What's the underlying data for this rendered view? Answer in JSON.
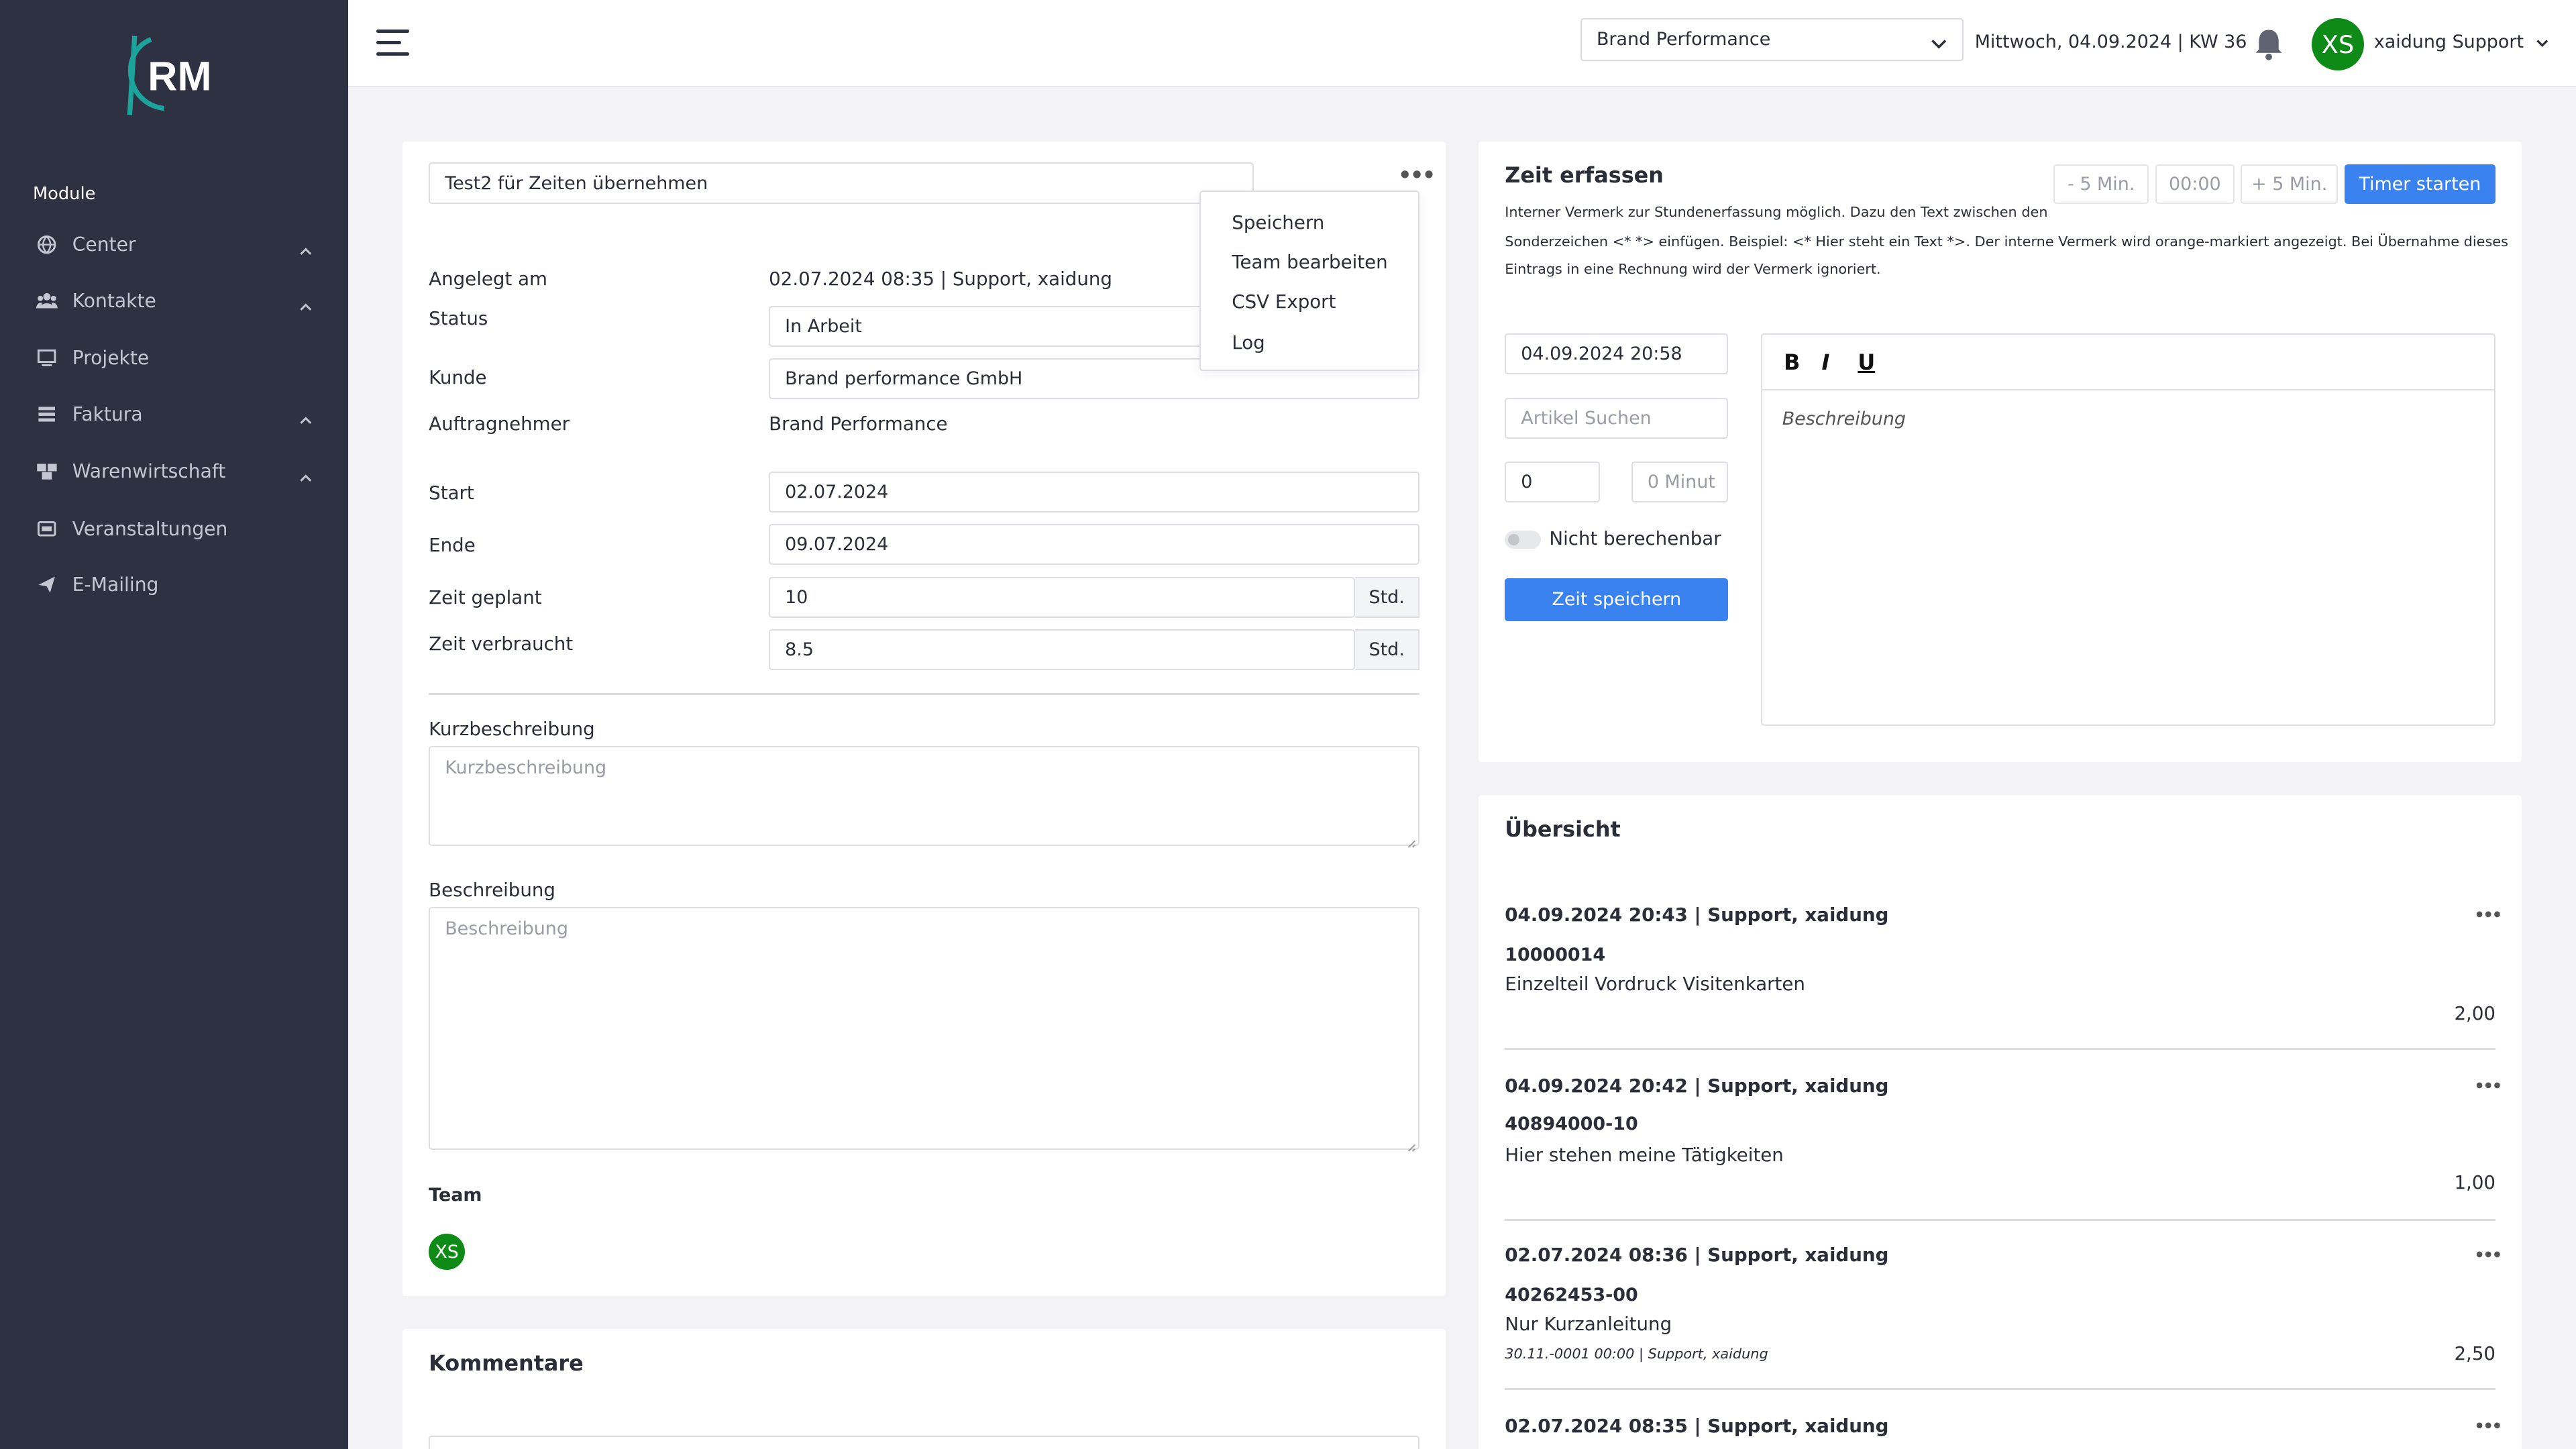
{
  "sidebar": {
    "logo_text": "RM",
    "section_label": "Module",
    "items": [
      {
        "label": "Center",
        "icon": "globe-icon",
        "expandable": true
      },
      {
        "label": "Kontakte",
        "icon": "users-icon",
        "expandable": true
      },
      {
        "label": "Projekte",
        "icon": "monitor-icon",
        "expandable": false
      },
      {
        "label": "Faktura",
        "icon": "stack-icon",
        "expandable": true
      },
      {
        "label": "Warenwirtschaft",
        "icon": "boxes-icon",
        "expandable": true
      },
      {
        "label": "Veranstaltungen",
        "icon": "ticket-icon",
        "expandable": false
      },
      {
        "label": "E-Mailing",
        "icon": "paper-plane-icon",
        "expandable": false
      }
    ]
  },
  "topbar": {
    "brand_select": "Brand Performance",
    "date_text": "Mittwoch, 04.09.2024 | KW 36",
    "user_initials": "XS",
    "user_name": "xaidung Support"
  },
  "project": {
    "title": "Test2 für Zeiten übernehmen",
    "menu": [
      "Speichern",
      "Team bearbeiten",
      "CSV Export",
      "Log"
    ],
    "created_label": "Angelegt am",
    "created_value": "02.07.2024 08:35 | Support, xaidung",
    "status_label": "Status",
    "status_value": "In Arbeit",
    "customer_label": "Kunde",
    "customer_value": "Brand performance GmbH",
    "contractor_label": "Auftragnehmer",
    "contractor_value": "Brand Performance",
    "start_label": "Start",
    "start_value": "02.07.2024",
    "end_label": "Ende",
    "end_value": "09.07.2024",
    "planned_label": "Zeit geplant",
    "planned_value": "10",
    "used_label": "Zeit verbraucht",
    "used_value": "8.5",
    "unit": "Std.",
    "short_desc_label": "Kurzbeschreibung",
    "short_desc_placeholder": "Kurzbeschreibung",
    "desc_label": "Beschreibung",
    "desc_placeholder": "Beschreibung",
    "team_label": "Team",
    "team_initials": "XS"
  },
  "comments": {
    "title": "Kommentare"
  },
  "time_entry": {
    "title": "Zeit erfassen",
    "minus_label": "- 5 Min.",
    "time_display": "00:00",
    "plus_label": "+ 5 Min.",
    "timer_button": "Timer starten",
    "note_line1": "Interner Vermerk zur Stundenerfassung möglich. Dazu den Text zwischen den",
    "note_line2": "Sonderzeichen <* *> einfügen. Beispiel: <* Hier steht ein Text *>. Der interne Vermerk wird orange-markiert angezeigt. Bei Übernahme dieses",
    "note_line3": "Eintrags in eine Rechnung wird der Vermerk ignoriert.",
    "datetime_value": "04.09.2024 20:58",
    "article_placeholder": "Artikel Suchen",
    "hours_value": "0",
    "minutes_placeholder": "0 Minut",
    "not_billable_label": "Nicht berechenbar",
    "save_button": "Zeit speichern",
    "editor_placeholder": "Beschreibung",
    "bold": "B",
    "italic": "I",
    "underline": "U"
  },
  "overview": {
    "title": "Übersicht",
    "entries": [
      {
        "head": "04.09.2024 20:43 | Support, xaidung",
        "code": "10000014",
        "desc": "Einzelteil Vordruck Visitenkarten",
        "meta": "",
        "amount": "2,00"
      },
      {
        "head": "04.09.2024 20:42 | Support, xaidung",
        "code": "40894000-10",
        "desc": "Hier stehen meine Tätigkeiten",
        "meta": "",
        "amount": "1,00"
      },
      {
        "head": "02.07.2024 08:36 | Support, xaidung",
        "code": "40262453-00",
        "desc": "Nur Kurzanleitung",
        "meta": "30.11.-0001 00:00 | Support, xaidung",
        "amount": "2,50"
      },
      {
        "head": "02.07.2024 08:35 | Support, xaidung",
        "code": "",
        "desc": "",
        "meta": "",
        "amount": ""
      }
    ]
  },
  "colors": {
    "sidebar_bg": "#2d3142",
    "accent_blue": "#3a82f0",
    "avatar_green": "#0e8a16",
    "logo_teal": "#1ba39c"
  }
}
